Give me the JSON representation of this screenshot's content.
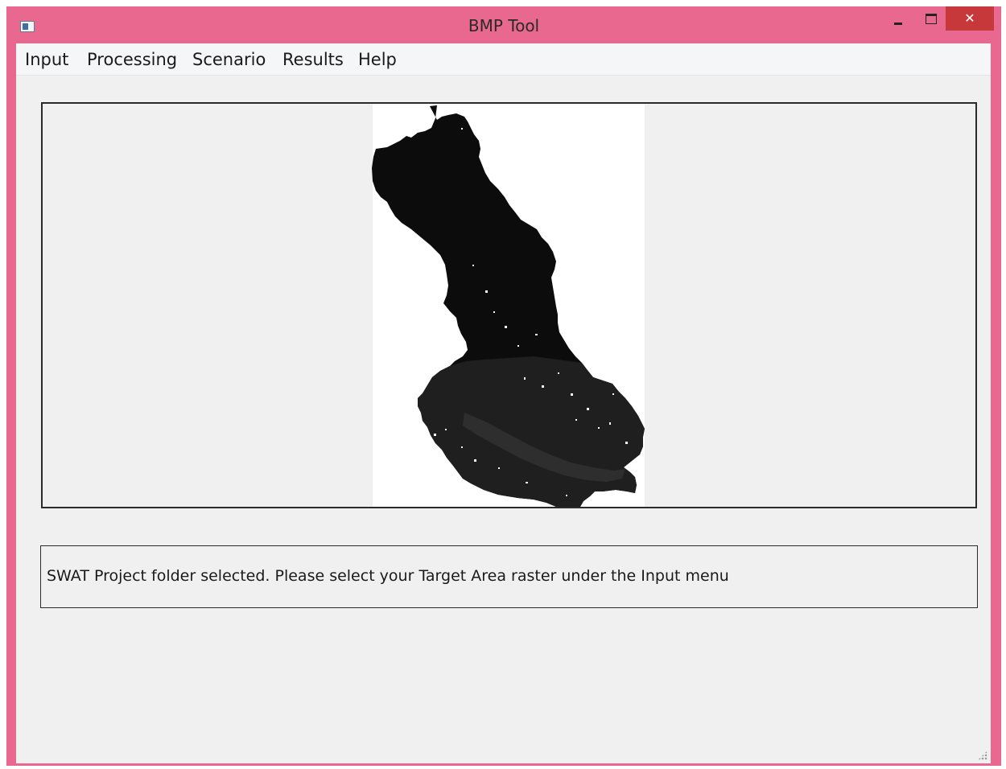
{
  "window": {
    "title": "BMP Tool",
    "close_glyph": "✕",
    "frame_color": "#e8688f",
    "close_color": "#c7383a"
  },
  "menu": {
    "items": [
      {
        "label": "Input"
      },
      {
        "label": "Processing"
      },
      {
        "label": "Scenario"
      },
      {
        "label": "Results"
      },
      {
        "label": "Help"
      }
    ]
  },
  "status": {
    "message": "SWAT Project folder selected. Please select your Target Area raster under the Input menu"
  },
  "icons": {
    "app": "app-window-icon",
    "minimize": "minimize-icon",
    "maximize": "maximize-icon",
    "close": "close-icon",
    "resize": "resize-grip-icon"
  }
}
